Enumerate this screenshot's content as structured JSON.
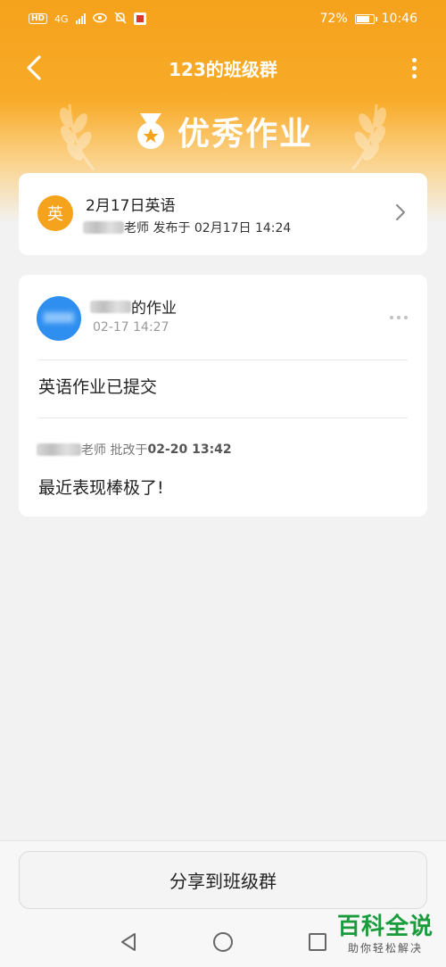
{
  "status_bar": {
    "hd": "HD",
    "network": "4G",
    "battery_text": "72%",
    "battery_level": 0.72,
    "time": "10:46"
  },
  "nav": {
    "title": "123的班级群"
  },
  "banner": {
    "title": "优秀作业"
  },
  "homework": {
    "subject_char": "英",
    "title": "2月17日英语",
    "teacher_suffix": "老师 发布于 02月17日 14:24"
  },
  "post": {
    "name_suffix": "的作业",
    "time": "02-17 14:27",
    "content": "英语作业已提交",
    "review_teacher_suffix": "老师 批改于",
    "review_time": "02-20 13:42",
    "review_comment": "最近表现棒极了!"
  },
  "share_button": {
    "label": "分享到班级群"
  },
  "watermark": {
    "title": "百科全说",
    "subtitle": "助你轻松解决"
  },
  "colors": {
    "accent": "#f5a21c",
    "avatar_blue": "#2e8ff0",
    "watermark_green": "#1a9b3c"
  }
}
